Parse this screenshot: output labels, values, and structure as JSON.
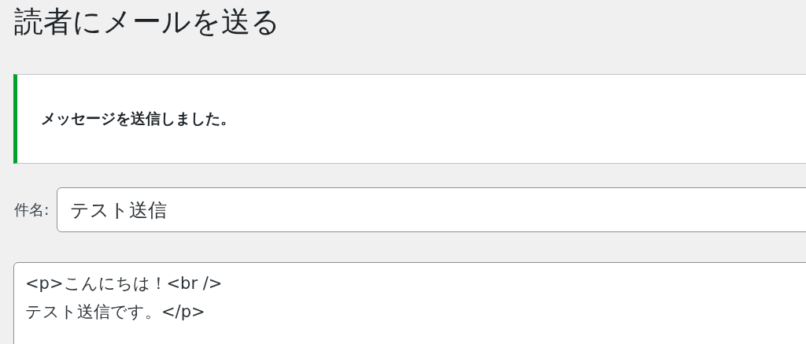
{
  "page_title": "読者にメールを送る",
  "notice": {
    "message": "メッセージを送信しました。",
    "kind": "success"
  },
  "subject": {
    "label": "件名:",
    "value": "テスト送信"
  },
  "body": {
    "value": "<p>こんにちは！<br />\nテスト送信です。</p>"
  }
}
